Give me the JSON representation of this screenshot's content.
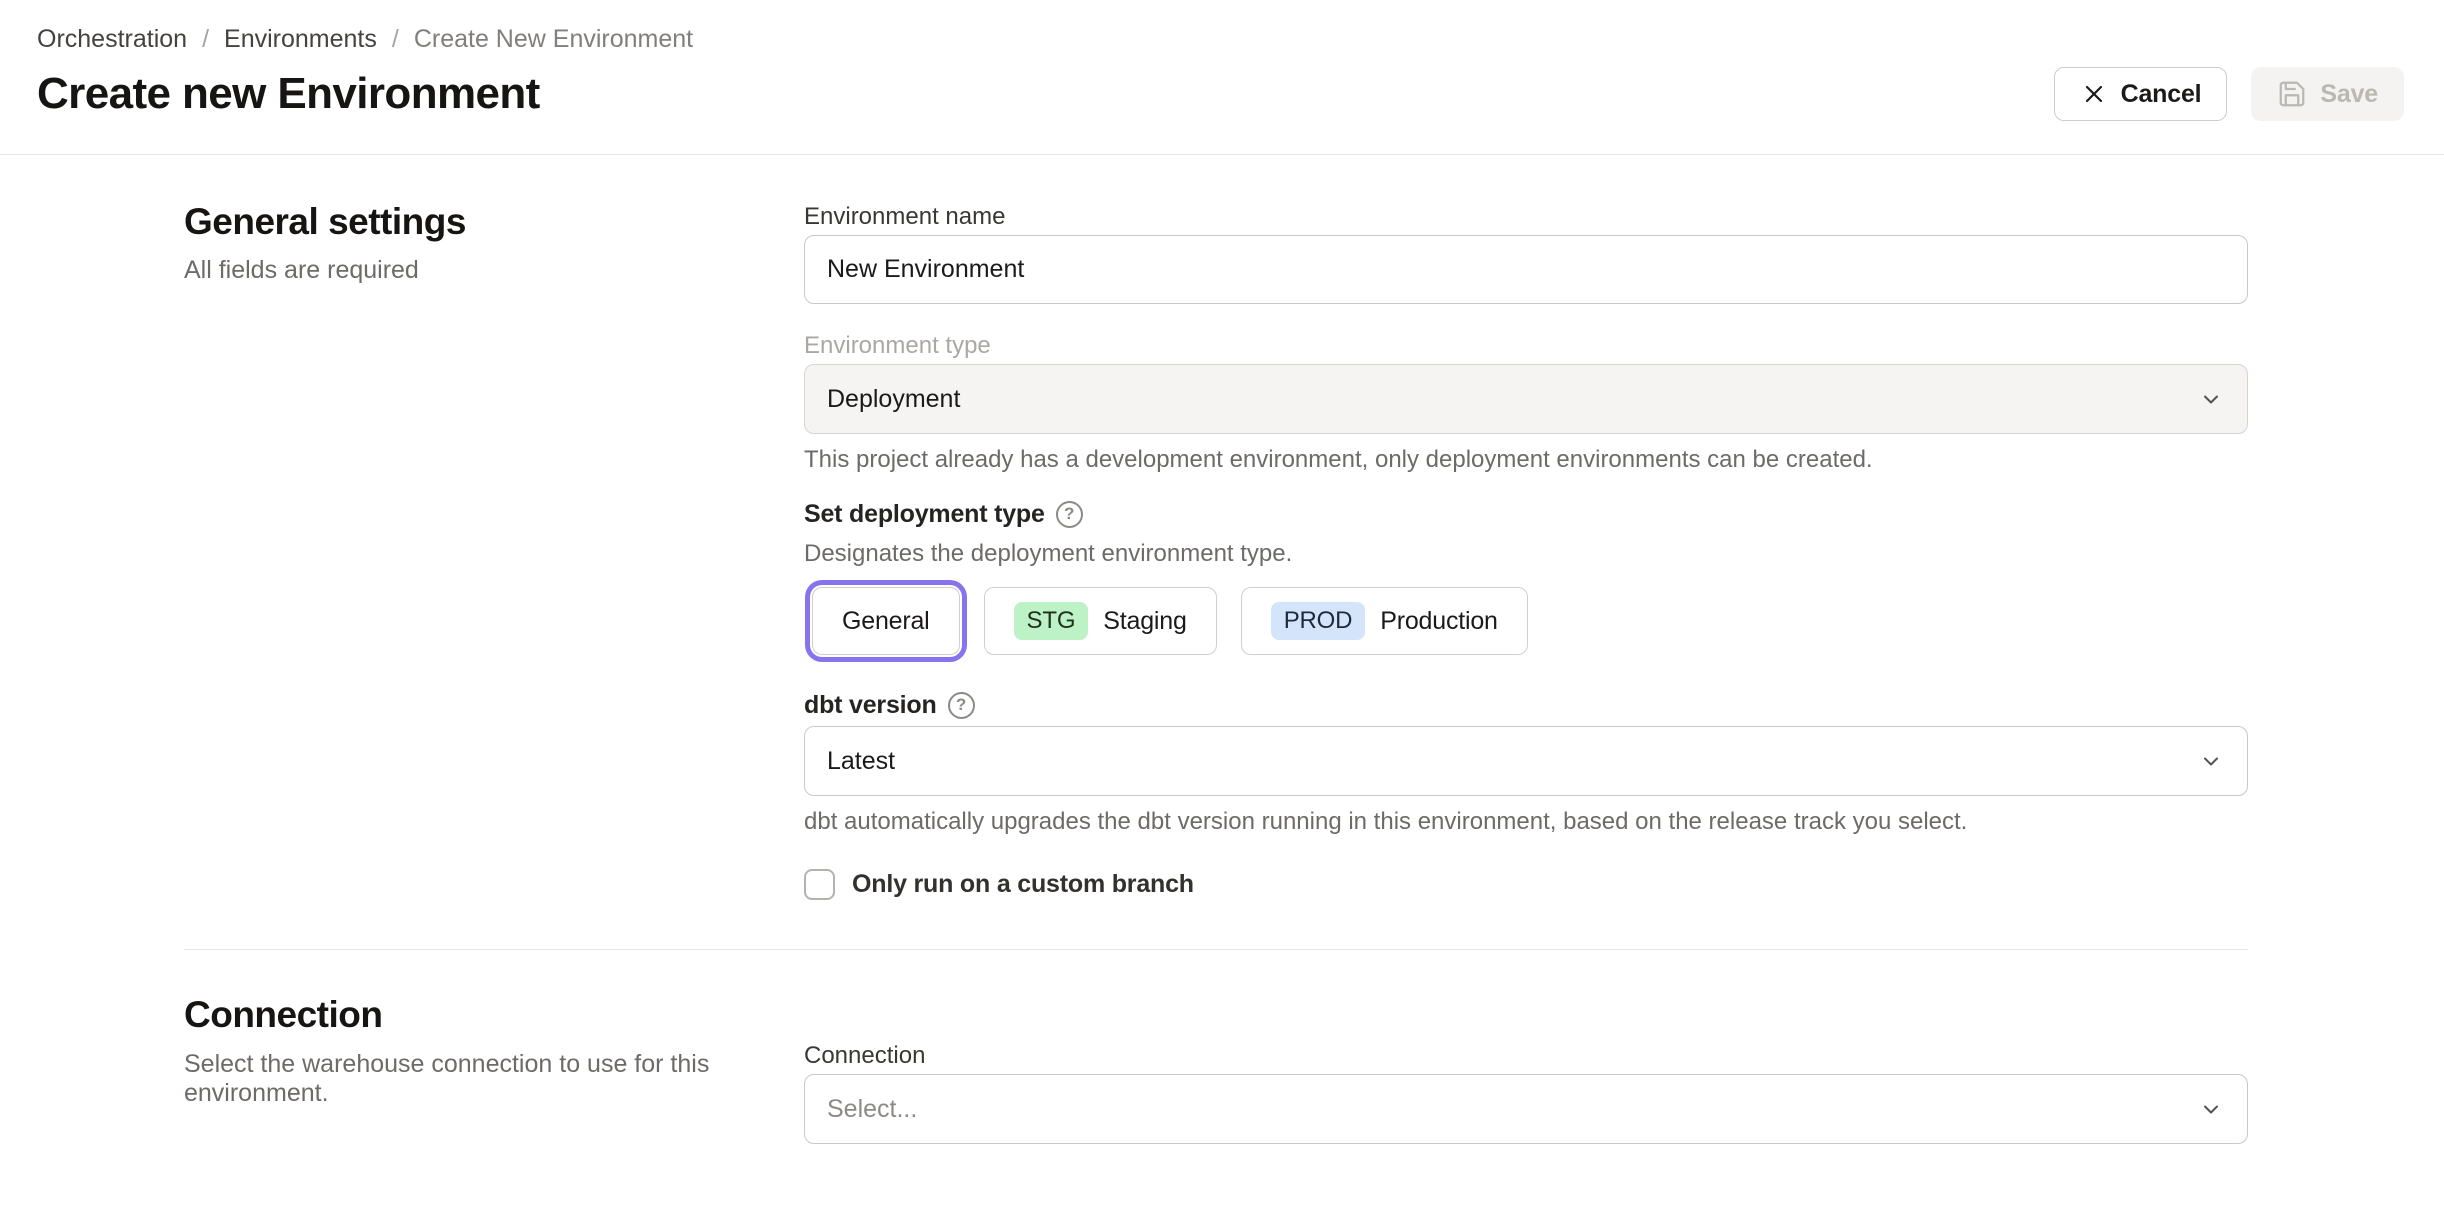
{
  "breadcrumb": {
    "separator": "/",
    "items": [
      {
        "label": "Orchestration"
      },
      {
        "label": "Environments"
      },
      {
        "label": "Create New Environment"
      }
    ]
  },
  "header": {
    "title": "Create new Environment",
    "cancel_label": "Cancel",
    "save_label": "Save"
  },
  "general_settings": {
    "heading": "General settings",
    "subheading": "All fields are required",
    "environment_name": {
      "label": "Environment name",
      "value": "New Environment"
    },
    "environment_type": {
      "label": "Environment type",
      "value": "Deployment",
      "helper": "This project already has a development environment, only deployment environments can be created."
    },
    "deployment_type": {
      "label": "Set deployment type",
      "description": "Designates the deployment environment type.",
      "options": [
        {
          "label": "General",
          "selected": true
        },
        {
          "badge": "STG",
          "label": "Staging",
          "selected": false
        },
        {
          "badge": "PROD",
          "label": "Production",
          "selected": false
        }
      ]
    },
    "dbt_version": {
      "label": "dbt version",
      "value": "Latest",
      "helper": "dbt automatically upgrades the dbt version running in this environment, based on the release track you select."
    },
    "custom_branch": {
      "label": "Only run on a custom branch",
      "checked": false
    }
  },
  "connection_section": {
    "heading": "Connection",
    "description": "Select the warehouse connection to use for this environment.",
    "connection": {
      "label": "Connection",
      "placeholder": "Select..."
    }
  },
  "icons": {
    "cancel": "x-icon",
    "save": "floppy-disk-icon",
    "help": "?",
    "dropdown": "chevron-down-icon"
  },
  "colors": {
    "accent_purple": "#8673EE",
    "badge_green": "#BDF2C6",
    "badge_blue": "#D4E5FB"
  }
}
